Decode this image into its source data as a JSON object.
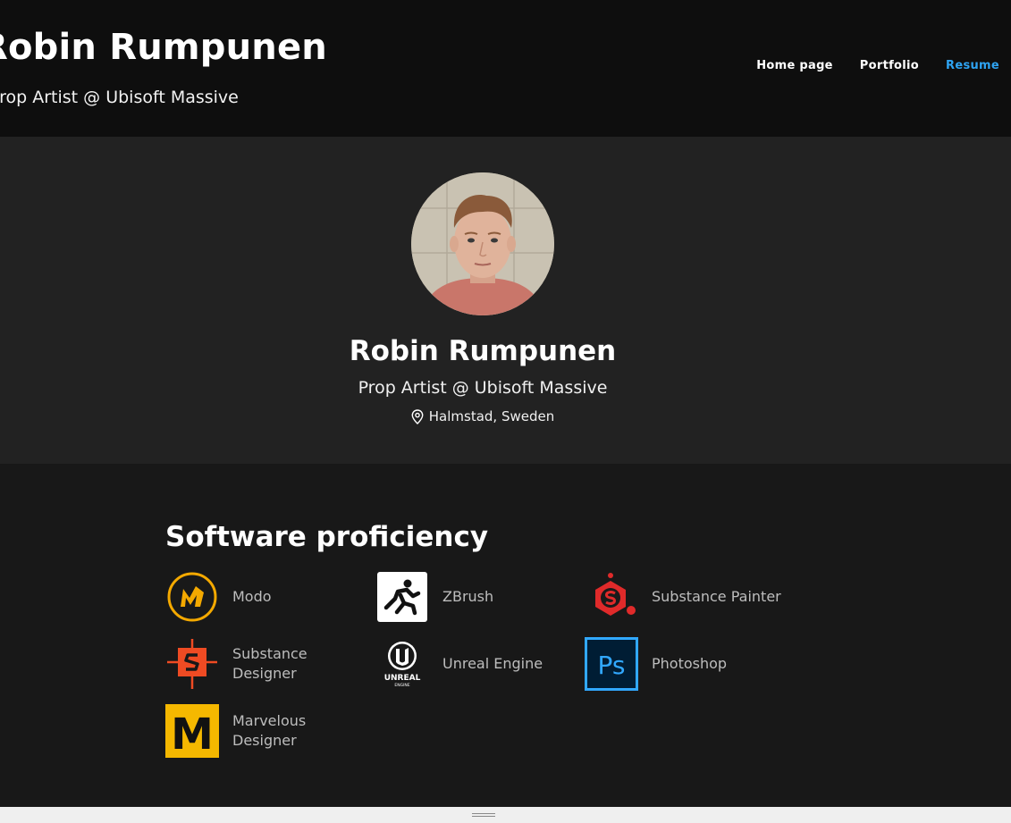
{
  "header": {
    "site_title": "Robin Rumpunen",
    "tagline": "Prop Artist @ Ubisoft Massive",
    "nav": [
      {
        "label": "Home page",
        "active": false
      },
      {
        "label": "Portfolio",
        "active": false
      },
      {
        "label": "Resume",
        "active": true
      }
    ],
    "active_color": "#2ea3f2"
  },
  "profile": {
    "name": "Robin Rumpunen",
    "role": "Prop Artist @ Ubisoft Massive",
    "location": "Halmstad, Sweden",
    "location_icon": "map-pin-icon",
    "avatar": "portrait-photo"
  },
  "skills": {
    "title": "Software proficiency",
    "items": [
      {
        "name": "Modo",
        "icon": "modo-logo-icon",
        "color": "#f4a900"
      },
      {
        "name": "ZBrush",
        "icon": "zbrush-logo-icon",
        "color": "#ffffff"
      },
      {
        "name": "Substance Painter",
        "icon": "substance-painter-logo-icon",
        "color": "#e02a2a"
      },
      {
        "name": "Substance Designer",
        "icon": "substance-designer-logo-icon",
        "color": "#ef4b23"
      },
      {
        "name": "Unreal Engine",
        "icon": "unreal-engine-logo-icon",
        "color": "#ffffff"
      },
      {
        "name": "Photoshop",
        "icon": "photoshop-logo-icon",
        "color": "#31a8ff"
      },
      {
        "name": "Marvelous Designer",
        "icon": "marvelous-designer-logo-icon",
        "color": "#f5b800"
      }
    ],
    "logo_text": {
      "unreal": "UNREAL",
      "unreal_sub": "ENGINE",
      "photoshop": "Ps",
      "marvelous": "M"
    }
  }
}
